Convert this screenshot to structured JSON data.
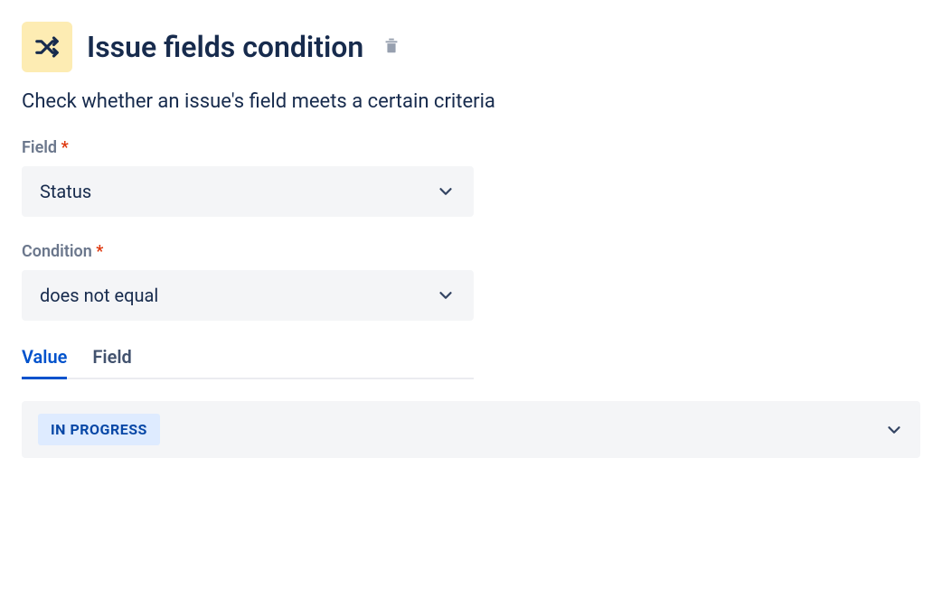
{
  "header": {
    "title": "Issue fields condition"
  },
  "description": "Check whether an issue's field meets a certain criteria",
  "fieldSection": {
    "label": "Field",
    "required": "*",
    "value": "Status"
  },
  "conditionSection": {
    "label": "Condition",
    "required": "*",
    "value": "does not equal"
  },
  "tabs": {
    "value": "Value",
    "field": "Field"
  },
  "valueSelect": {
    "status": "IN PROGRESS"
  }
}
